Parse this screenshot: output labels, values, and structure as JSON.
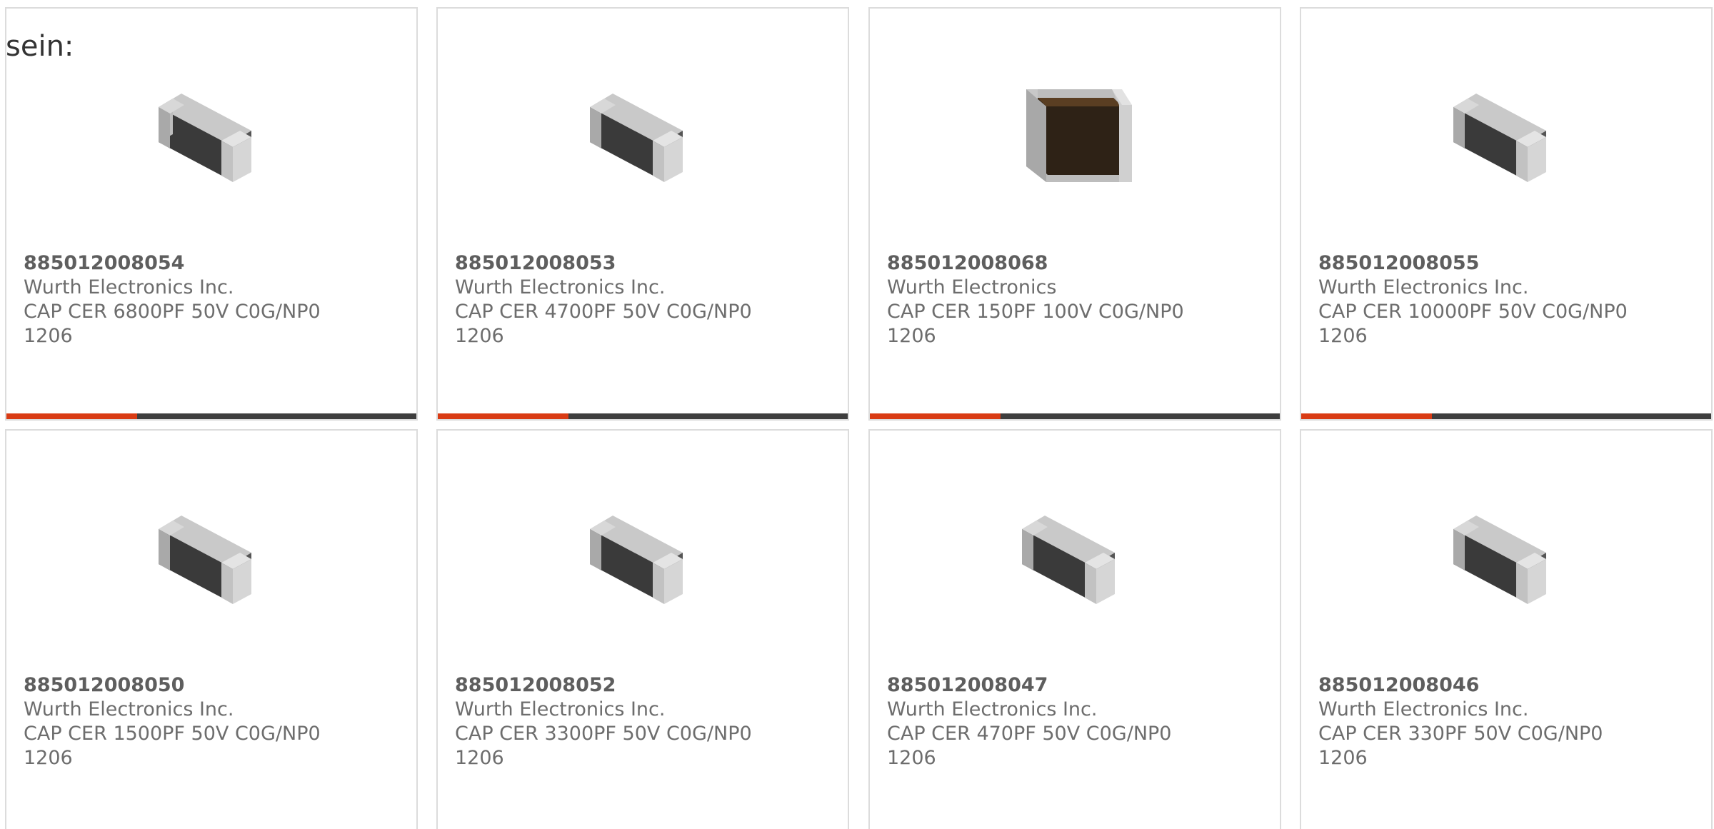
{
  "intro_text": "sein:",
  "colors": {
    "accent_orange": "#d93b14",
    "accent_dark": "#3e3e3e",
    "text": "#6d6d6d",
    "border": "#dcdcdc"
  },
  "products": [
    {
      "part_number": "885012008054",
      "manufacturer": "Wurth Electronics Inc.",
      "description": "CAP CER 6800PF 50V C0G/NP0",
      "package": "1206",
      "image_icon": "ceramic-capacitor-gray-icon"
    },
    {
      "part_number": "885012008053",
      "manufacturer": "Wurth Electronics Inc.",
      "description": "CAP CER 4700PF 50V C0G/NP0",
      "package": "1206",
      "image_icon": "ceramic-capacitor-gray-icon"
    },
    {
      "part_number": "885012008068",
      "manufacturer": "Wurth Electronics",
      "description": "CAP CER 150PF 100V C0G/NP0",
      "package": "1206",
      "image_icon": "ceramic-capacitor-brown-icon"
    },
    {
      "part_number": "885012008055",
      "manufacturer": "Wurth Electronics Inc.",
      "description": "CAP CER 10000PF 50V C0G/NP0",
      "package": "1206",
      "image_icon": "ceramic-capacitor-gray-icon"
    },
    {
      "part_number": "885012008050",
      "manufacturer": "Wurth Electronics Inc.",
      "description": "CAP CER 1500PF 50V C0G/NP0",
      "package": "1206",
      "image_icon": "ceramic-capacitor-gray-icon"
    },
    {
      "part_number": "885012008052",
      "manufacturer": "Wurth Electronics Inc.",
      "description": "CAP CER 3300PF 50V C0G/NP0",
      "package": "1206",
      "image_icon": "ceramic-capacitor-gray-icon"
    },
    {
      "part_number": "885012008047",
      "manufacturer": "Wurth Electronics Inc.",
      "description": "CAP CER 470PF 50V C0G/NP0",
      "package": "1206",
      "image_icon": "ceramic-capacitor-gray-icon"
    },
    {
      "part_number": "885012008046",
      "manufacturer": "Wurth Electronics Inc.",
      "description": "CAP CER 330PF 50V C0G/NP0",
      "package": "1206",
      "image_icon": "ceramic-capacitor-gray-icon"
    }
  ]
}
